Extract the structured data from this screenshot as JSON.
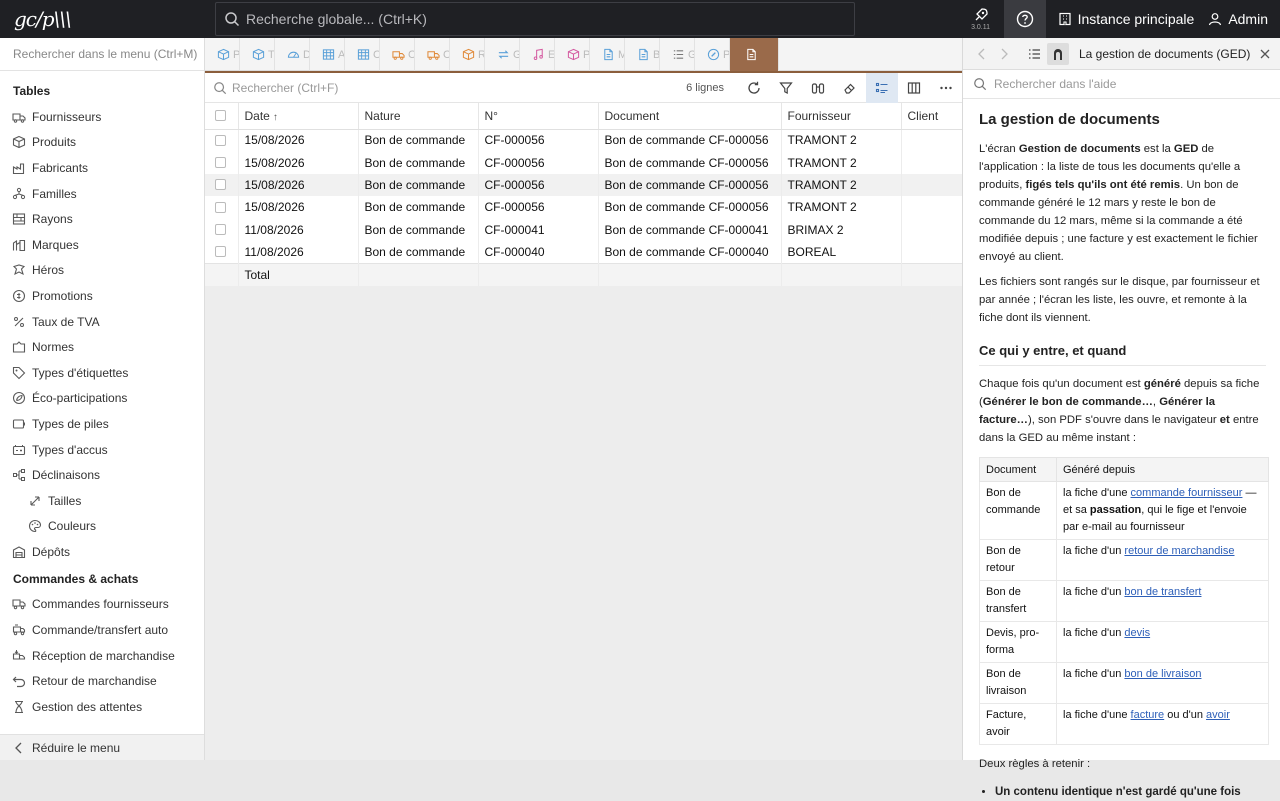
{
  "topbar": {
    "logo_text": "gc/p\\\\\\",
    "search_placeholder": "Recherche globale... (Ctrl+K)",
    "version": "3.0.11",
    "instance_label": "Instance principale",
    "user_label": "Admin"
  },
  "sidebar": {
    "search_placeholder": "Rechercher dans le menu (Ctrl+M)",
    "section1_title": "Tables",
    "section1_items": [
      {
        "label": "Fournisseurs",
        "icon": "truck-icon"
      },
      {
        "label": "Produits",
        "icon": "box-icon"
      },
      {
        "label": "Fabricants",
        "icon": "factory-icon"
      },
      {
        "label": "Familles",
        "icon": "family-icon"
      },
      {
        "label": "Rayons",
        "icon": "shelves-icon"
      },
      {
        "label": "Marques",
        "icon": "brand-icon"
      },
      {
        "label": "Héros",
        "icon": "hero-icon"
      },
      {
        "label": "Promotions",
        "icon": "promo-icon"
      },
      {
        "label": "Taux de TVA",
        "icon": "percent-icon"
      },
      {
        "label": "Normes",
        "icon": "norms-icon"
      },
      {
        "label": "Types d'étiquettes",
        "icon": "tag-icon"
      },
      {
        "label": "Éco-participations",
        "icon": "eco-icon"
      },
      {
        "label": "Types de piles",
        "icon": "battery-icon"
      },
      {
        "label": "Types d'accus",
        "icon": "accu-icon"
      },
      {
        "label": "Déclinaisons",
        "icon": "variants-icon"
      }
    ],
    "sub_items": [
      {
        "label": "Tailles",
        "icon": "size-icon"
      },
      {
        "label": "Couleurs",
        "icon": "palette-icon"
      }
    ],
    "after_sub": {
      "label": "Dépôts",
      "icon": "warehouse-icon"
    },
    "section2_title": "Commandes & achats",
    "section2_items": [
      {
        "label": "Commandes fournisseurs",
        "icon": "order-icon"
      },
      {
        "label": "Commande/transfert auto",
        "icon": "auto-order-icon"
      },
      {
        "label": "Réception de marchandise",
        "icon": "reception-icon"
      },
      {
        "label": "Retour de marchandise",
        "icon": "return-icon"
      },
      {
        "label": "Gestion des attentes",
        "icon": "hourglass-icon"
      }
    ],
    "collapse_label": "Réduire le menu"
  },
  "tabs": [
    {
      "label": "P",
      "icon": "box-icon",
      "color": "#5aa0d8"
    },
    {
      "label": "T",
      "icon": "box-icon",
      "color": "#5aa0d8"
    },
    {
      "label": "D",
      "icon": "dashboard-icon",
      "color": "#5aa0d8"
    },
    {
      "label": "A",
      "icon": "table-icon",
      "color": "#5aa0d8"
    },
    {
      "label": "C",
      "icon": "table-icon",
      "color": "#5aa0d8"
    },
    {
      "label": "C",
      "icon": "truck-icon",
      "color": "#e08a3a"
    },
    {
      "label": "C",
      "icon": "truck-icon",
      "color": "#e08a3a"
    },
    {
      "label": "R",
      "icon": "box-icon",
      "color": "#e08a3a"
    },
    {
      "label": "G",
      "icon": "transfer-icon",
      "color": "#5aa0d8"
    },
    {
      "label": "E",
      "icon": "music-icon",
      "color": "#d45aa0"
    },
    {
      "label": "P",
      "icon": "box-icon",
      "color": "#d45aa0"
    },
    {
      "label": "M",
      "icon": "doc-icon",
      "color": "#5aa0d8"
    },
    {
      "label": "B",
      "icon": "doc-icon",
      "color": "#5aa0d8"
    },
    {
      "label": "G",
      "icon": "list-icon",
      "color": "#777777"
    },
    {
      "label": "P",
      "icon": "badge-icon",
      "color": "#5aa0d8"
    }
  ],
  "grid": {
    "search_placeholder": "Rechercher (Ctrl+F)",
    "row_count": "6 lignes",
    "columns": [
      "Date",
      "Nature",
      "N°",
      "Document",
      "Fournisseur",
      "Client"
    ],
    "sort_indicator": "↑",
    "rows": [
      [
        "15/08/2026",
        "Bon de commande",
        "CF-000056",
        "Bon de commande CF-000056",
        "TRAMONT 2",
        ""
      ],
      [
        "15/08/2026",
        "Bon de commande",
        "CF-000056",
        "Bon de commande CF-000056",
        "TRAMONT 2",
        ""
      ],
      [
        "15/08/2026",
        "Bon de commande",
        "CF-000056",
        "Bon de commande CF-000056",
        "TRAMONT 2",
        ""
      ],
      [
        "15/08/2026",
        "Bon de commande",
        "CF-000056",
        "Bon de commande CF-000056",
        "TRAMONT 2",
        ""
      ],
      [
        "11/08/2026",
        "Bon de commande",
        "CF-000041",
        "Bon de commande CF-000041",
        "BRIMAX 2",
        ""
      ],
      [
        "11/08/2026",
        "Bon de commande",
        "CF-000040",
        "Bon de commande CF-000040",
        "BOREAL",
        ""
      ]
    ],
    "total_label": "Total"
  },
  "help": {
    "title": "La gestion de documents (GED)",
    "search_placeholder": "Rechercher dans l'aide",
    "h1": "La gestion de documents",
    "p1": {
      "a": "L'écran ",
      "b": "Gestion de documents",
      "c": " est la ",
      "d": "GED",
      "e": " de l'application : la liste de tous les documents qu'elle a produits, ",
      "f": "figés tels qu'ils ont été remis",
      "g": ". Un bon de commande généré le 12 mars y reste le bon de commande du 12 mars, même si la commande a été modifiée depuis ; une facture y est exactement le fichier envoyé au client."
    },
    "p2": "Les fichiers sont rangés sur le disque, par fournisseur et par année ; l'écran les liste, les ouvre, et remonte à la fiche dont ils viennent.",
    "h2": "Ce qui y entre, et quand",
    "p3": {
      "a": "Chaque fois qu'un document est ",
      "b": "généré",
      "c": " depuis sa fiche (",
      "d": "Générer le bon de commande…",
      "e": ", ",
      "f": "Générer la facture…",
      "g": "), son PDF s'ouvre dans le navigateur ",
      "h": "et",
      "i": " entre dans la GED au même instant :"
    },
    "table_headers": [
      "Document",
      "Généré depuis"
    ],
    "table_rows": [
      {
        "doc": "Bon de commande",
        "pre": "la fiche d'une ",
        "link": "commande fournisseur",
        "post": " — et sa ",
        "bold": "passation",
        "post2": ", qui le fige et l'envoie par e-mail au fournisseur"
      },
      {
        "doc": "Bon de retour",
        "pre": "la fiche d'un ",
        "link": "retour de marchandise",
        "post": "",
        "bold": "",
        "post2": ""
      },
      {
        "doc": "Bon de transfert",
        "pre": "la fiche d'un ",
        "link": "bon de transfert",
        "post": "",
        "bold": "",
        "post2": ""
      },
      {
        "doc": "Devis, pro-forma",
        "pre": "la fiche d'un ",
        "link": "devis",
        "post": "",
        "bold": "",
        "post2": ""
      },
      {
        "doc": "Bon de livraison",
        "pre": "la fiche d'un ",
        "link": "bon de livraison",
        "post": "",
        "bold": "",
        "post2": ""
      },
      {
        "doc": "Facture, avoir",
        "pre": "la fiche d'une ",
        "link": "facture",
        "post": " ou d'un ",
        "bold": "",
        "post2": "",
        "link2": "avoir"
      }
    ],
    "p4": "Deux règles à retenir :",
    "li1": "Un contenu identique n'est gardé qu'une fois"
  }
}
